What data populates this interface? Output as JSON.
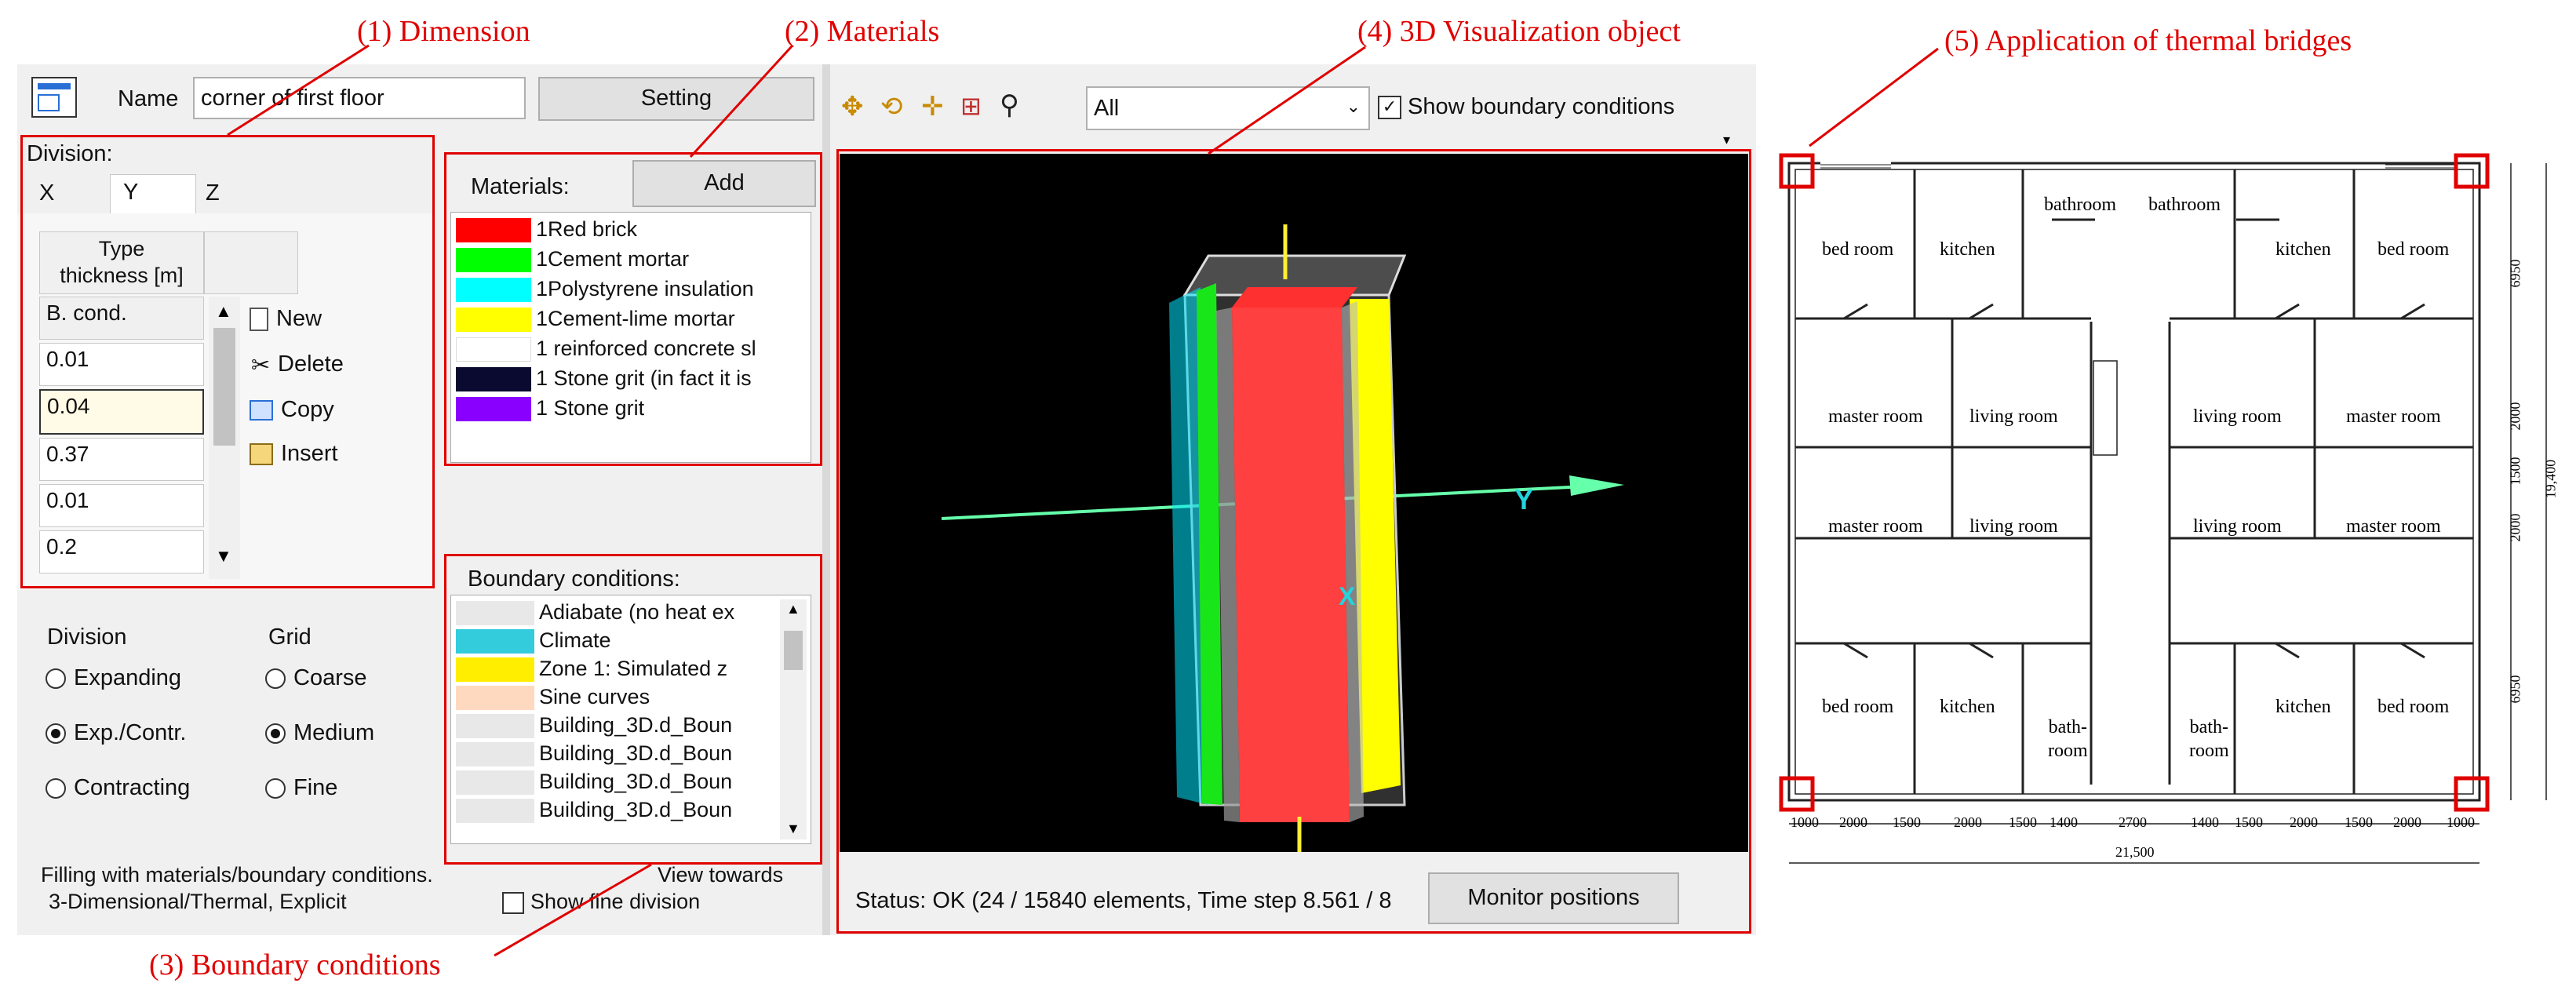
{
  "annotations": {
    "dimension": "(1) Dimension",
    "materials": "(2) Materials",
    "boundary": "(3) Boundary conditions",
    "visualization": "(4) 3D Visualization object",
    "thermal": "(5) Application of thermal bridges"
  },
  "colors": {
    "annotation": "#e00000"
  },
  "header": {
    "name_label": "Name",
    "name_value": "corner of first floor",
    "setting_button": "Setting",
    "window_icon": "window-icon"
  },
  "division_panel": {
    "title": "Division:",
    "tabs": [
      "X",
      "Y",
      "Z"
    ],
    "active_tab": "Y",
    "header": "Type\nthickness [m]",
    "rows": [
      "B. cond.",
      "0.01",
      "0.04",
      "0.37",
      "0.01",
      "0.2"
    ],
    "actions": [
      {
        "label": "New",
        "icon": "new-file-icon"
      },
      {
        "label": "Delete",
        "icon": "delete-icon"
      },
      {
        "label": "Copy",
        "icon": "copy-icon"
      },
      {
        "label": "Insert",
        "icon": "insert-icon"
      }
    ]
  },
  "materials": {
    "label": "Materials:",
    "add_button": "Add",
    "items": [
      {
        "name": "1Red brick",
        "color": "#ff0000"
      },
      {
        "name": "1Cement mortar",
        "color": "#00ff00"
      },
      {
        "name": "1Polystyrene insulation",
        "color": "#00ffff"
      },
      {
        "name": "1Cement-lime mortar",
        "color": "#ffff00"
      },
      {
        "name": "1 reinforced concrete sl",
        "color": "#ffffff"
      },
      {
        "name": "1 Stone grit (in fact it is",
        "color": "#0a0a30"
      },
      {
        "name": "1 Stone grit",
        "color": "#8a00ff"
      }
    ]
  },
  "boundary": {
    "label": "Boundary conditions:",
    "items": [
      {
        "name": "Adiabate (no heat ex",
        "color": "#e8e8e8"
      },
      {
        "name": "Climate",
        "color": "#33ccdd"
      },
      {
        "name": "Zone 1: Simulated z",
        "color": "#ffee00"
      },
      {
        "name": "Sine curves",
        "color": "#ffd9bf"
      },
      {
        "name": "Building_3D.d_Boun",
        "color": "#e8e8e8"
      },
      {
        "name": "Building_3D.d_Boun",
        "color": "#e8e8e8"
      },
      {
        "name": "Building_3D.d_Boun",
        "color": "#e8e8e8"
      },
      {
        "name": "Building_3D.d_Boun",
        "color": "#e8e8e8"
      }
    ]
  },
  "options": {
    "division_title": "Division",
    "division_options": [
      "Expanding",
      "Exp./Contr.",
      "Contracting"
    ],
    "division_selected": "Exp./Contr.",
    "grid_title": "Grid",
    "grid_options": [
      "Coarse",
      "Medium",
      "Fine"
    ],
    "grid_selected": "Medium",
    "filling": "Filling with materials/boundary conditions.",
    "mode": "3-Dimensional/Thermal, Explicit",
    "view_towards": "View towards",
    "show_fine": "Show fine division",
    "show_fine_checked": false
  },
  "toolbar": {
    "icons": [
      "rotate-x-icon",
      "rotate-xy-icon",
      "move-icon",
      "fit-view-icon",
      "zoom-icon"
    ],
    "select_value": "All",
    "show_boundary": "Show boundary conditions",
    "show_boundary_checked": true
  },
  "viewport": {
    "axis_y": "Y",
    "axis_x": "X"
  },
  "status": {
    "text": "Status: OK (24 / 15840 elements, Time step 8.561 / 8",
    "monitor_button": "Monitor positions"
  },
  "floorplan": {
    "rooms_top_left": [
      "bed room",
      "kitchen",
      "bathroom"
    ],
    "rooms_top_right": [
      "bathroom",
      "kitchen",
      "bed room"
    ],
    "rooms_mid": [
      "master room",
      "living room",
      "living room",
      "master room"
    ],
    "rooms_bottom": [
      "bed room",
      "kitchen",
      "bath-\nroom",
      "bath-\nroom",
      "kitchen",
      "bed room"
    ],
    "dims_bottom": [
      "1000",
      "2000",
      "1500",
      "2000",
      "1500",
      "1400",
      "2700",
      "1400",
      "1500",
      "2000",
      "1500",
      "2000",
      "1000"
    ],
    "total_width": "21,500",
    "dims_right": [
      "6950",
      "2000",
      "1500",
      "2000",
      "6950"
    ],
    "total_height": "19,400"
  }
}
